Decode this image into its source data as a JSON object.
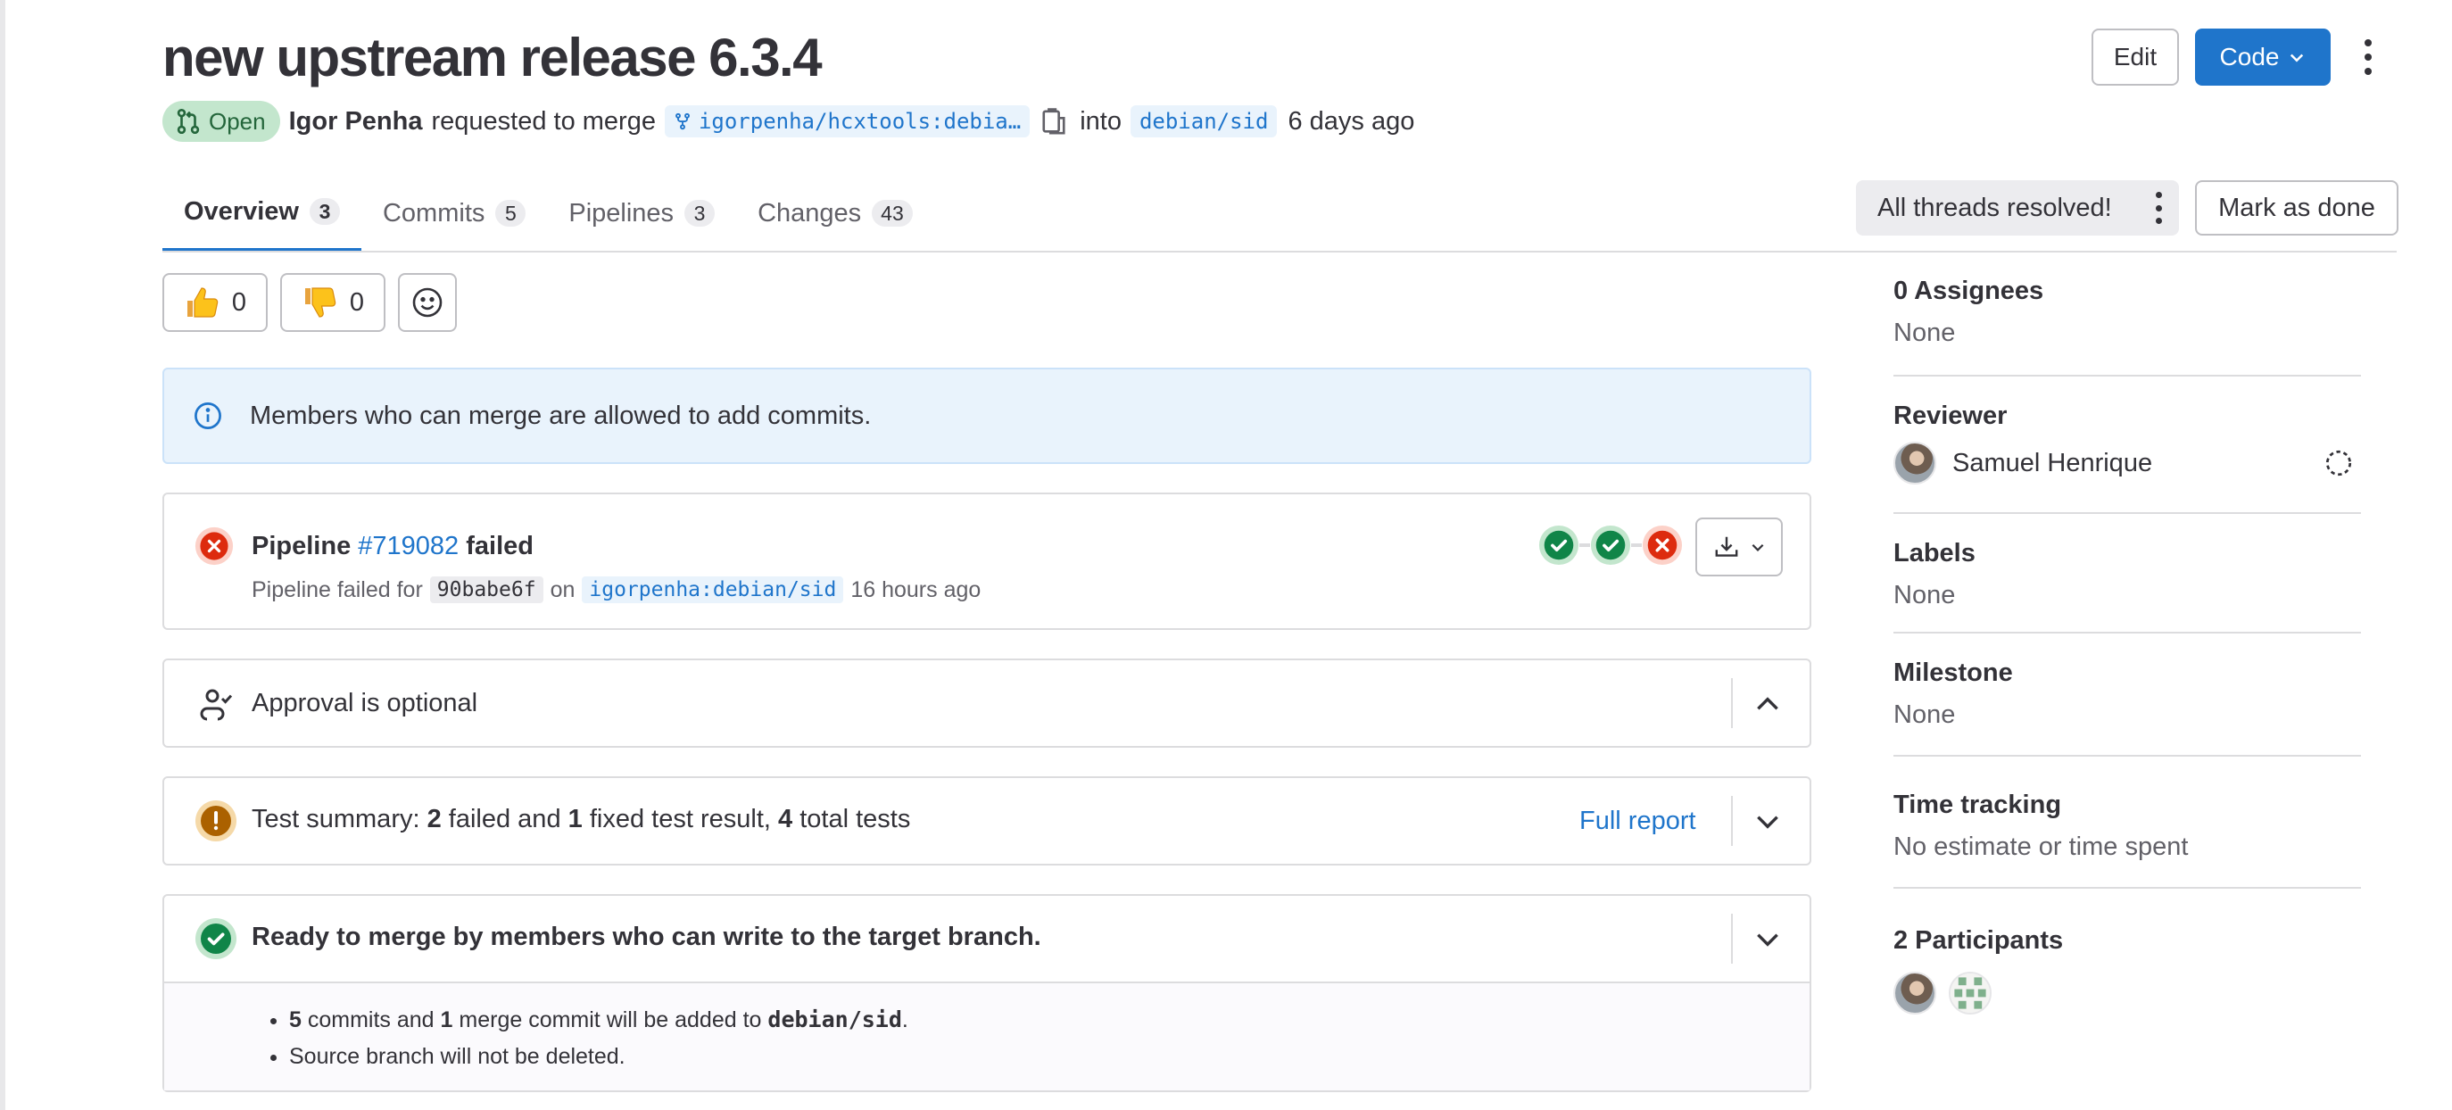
{
  "header": {
    "title": "new upstream release 6.3.4",
    "status": "Open",
    "author": "Igor Penha",
    "requested_text": "requested to merge",
    "source_branch": "igorpenha/hcxtools:debia…",
    "into_text": "into",
    "target_branch": "debian/sid",
    "age": "6 days ago",
    "edit_label": "Edit",
    "code_label": "Code"
  },
  "tabs": [
    {
      "label": "Overview",
      "count": "3"
    },
    {
      "label": "Commits",
      "count": "5"
    },
    {
      "label": "Pipelines",
      "count": "3"
    },
    {
      "label": "Changes",
      "count": "43"
    }
  ],
  "threads_label": "All threads resolved!",
  "mark_done_label": "Mark as done",
  "reactions": {
    "thumbs_up": "0",
    "thumbs_down": "0"
  },
  "info_alert": "Members who can merge are allowed to add commits.",
  "pipeline": {
    "prefix": "Pipeline",
    "id": "#719082",
    "status": "failed",
    "detail_prefix": "Pipeline failed for",
    "commit": "90babe6f",
    "on_text": "on",
    "ref": "igorpenha:debian/sid",
    "age": "16 hours ago",
    "stages": [
      "success",
      "success",
      "failed"
    ]
  },
  "approval": {
    "text": "Approval is optional"
  },
  "test_summary": {
    "prefix": "Test summary:",
    "failed": "2",
    "failed_text": "failed and",
    "fixed": "1",
    "fixed_text": "fixed test result,",
    "total": "4",
    "total_text": "total tests",
    "full_report": "Full report"
  },
  "ready": {
    "title": "Ready to merge by members who can write to the target branch.",
    "commits_count": "5",
    "commits_text": "commits and",
    "merge_count": "1",
    "merge_text": "merge commit will be added to",
    "target": "debian/sid",
    "period": ".",
    "source_note": "Source branch will not be deleted."
  },
  "sidebar": {
    "assignees_title": "0 Assignees",
    "assignees_value": "None",
    "reviewer_title": "Reviewer",
    "reviewer_name": "Samuel Henrique",
    "labels_title": "Labels",
    "labels_value": "None",
    "milestone_title": "Milestone",
    "milestone_value": "None",
    "time_title": "Time tracking",
    "time_value": "No estimate or time spent",
    "participants_title": "2 Participants"
  },
  "colors": {
    "accent": "#1f75cb",
    "success": "#108548",
    "danger": "#dd2b0e",
    "warning": "#ab6100"
  }
}
